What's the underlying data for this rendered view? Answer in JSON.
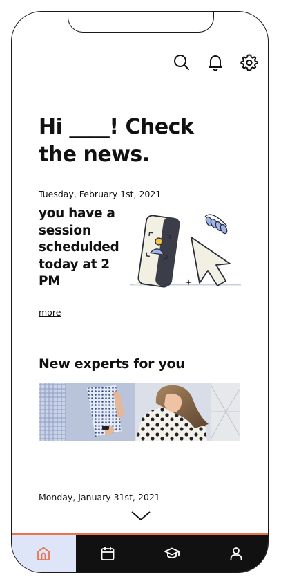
{
  "header": {
    "icons": [
      "search-icon",
      "bell-icon",
      "gear-icon"
    ]
  },
  "greeting": {
    "line1": "Hi ____! Check",
    "line2": "the news."
  },
  "news_item_1": {
    "date": "Tuesday, February 1st, 2021",
    "text": "you have a session schedulded today at 2 PM",
    "more_label": "more"
  },
  "experts": {
    "title": "New experts for you"
  },
  "news_item_2": {
    "date": "Monday, January 31st, 2021"
  },
  "tabbar": {
    "items": [
      "home-icon",
      "calendar-icon",
      "graduation-cap-icon",
      "profile-icon"
    ],
    "active_index": 0,
    "accent": "#e8734f",
    "active_bg": "#dfe5f8",
    "bar_bg": "#111111"
  }
}
